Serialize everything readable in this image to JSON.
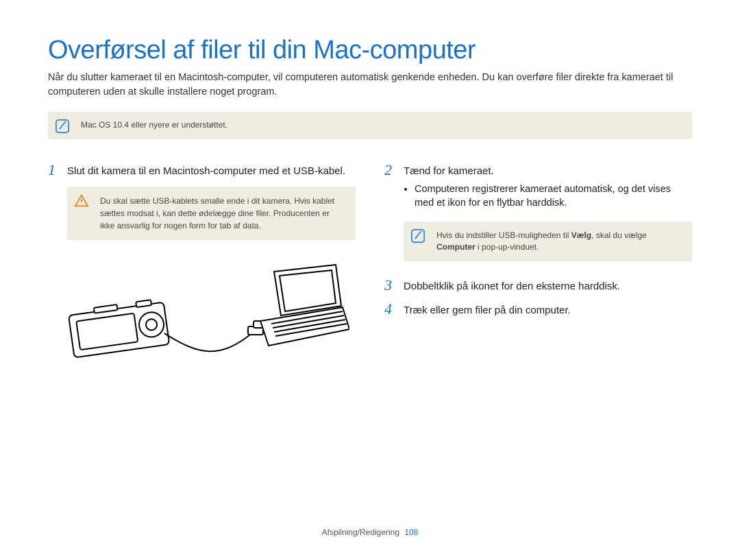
{
  "title": "Overførsel af filer til din Mac-computer",
  "intro": "Når du slutter kameraet til en Macintosh-computer, vil computeren automatisk genkende enheden. Du kan overføre filer direkte fra kameraet til computeren uden at skulle installere noget program.",
  "note_top": "Mac OS 10.4 eller nyere er understøttet.",
  "left": {
    "step1_num": "1",
    "step1_text": "Slut dit kamera til en Macintosh-computer med et USB-kabel.",
    "warn_text": "Du skal sætte USB-kablets smalle ende i dit kamera. Hvis kablet sættes modsat i, kan dette ødelægge dine filer. Producenten er ikke ansvarlig for nogen form for tab af data."
  },
  "right": {
    "step2_num": "2",
    "step2_text": "Tænd for kameraet.",
    "step2_bullet": "Computeren registrerer kameraet automatisk, og det vises med et ikon for en flytbar harddisk.",
    "note_prefix": "Hvis du indstiller USB-muligheden til ",
    "note_bold1": "Vælg",
    "note_mid": ", skal du vælge ",
    "note_bold2": "Computer",
    "note_suffix": " i pop-up-vinduet.",
    "step3_num": "3",
    "step3_text": "Dobbeltklik på ikonet for den eksterne harddisk.",
    "step4_num": "4",
    "step4_text": "Træk eller gem filer på din computer."
  },
  "footer_section": "Afspilning/Redigering",
  "footer_page": "108"
}
